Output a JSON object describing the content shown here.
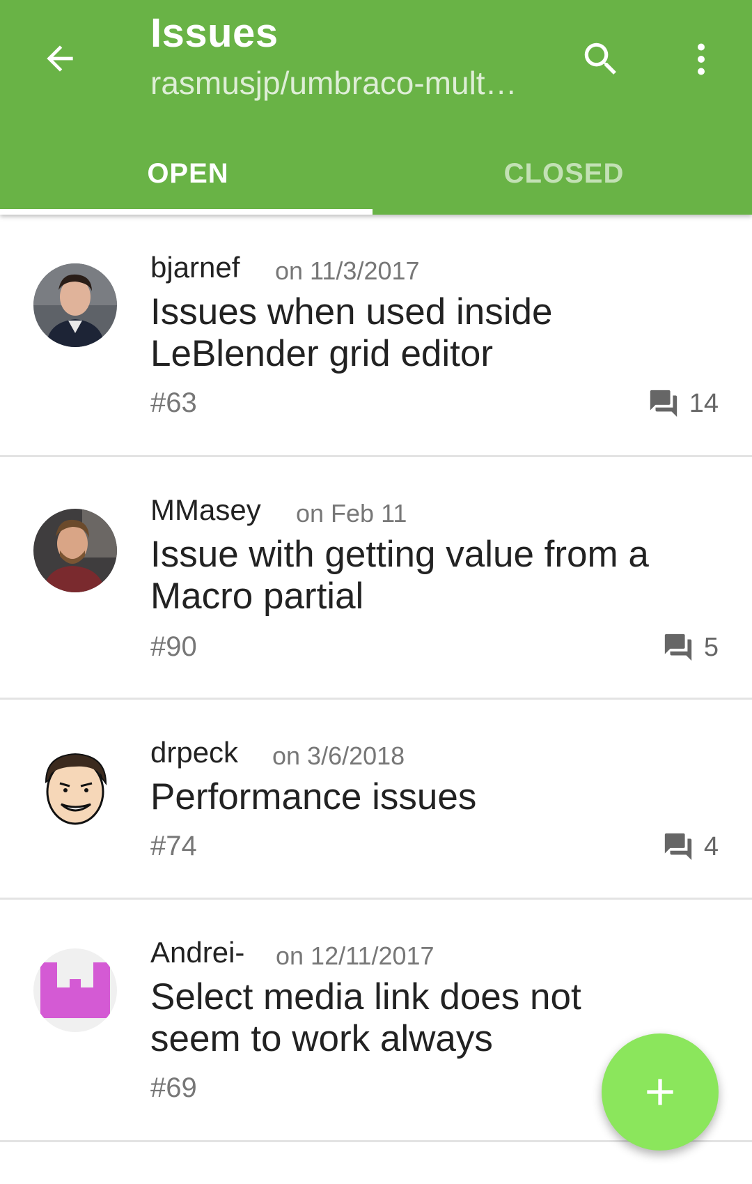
{
  "appbar": {
    "title": "Issues",
    "subtitle": "rasmusjp/umbraco-mult…",
    "back_icon": "arrow-back-icon",
    "search_icon": "search-icon",
    "more_icon": "more-vert-icon"
  },
  "tabs": [
    {
      "label": "OPEN",
      "active": true
    },
    {
      "label": "CLOSED",
      "active": false
    }
  ],
  "issues": [
    {
      "user": "bjarnef",
      "date": "on 11/3/2017",
      "title": "Issues when used inside LeBlender grid editor",
      "number": "#63",
      "comments": "14"
    },
    {
      "user": "MMasey",
      "date": "on Feb 11",
      "title": "Issue with getting value from a Macro partial",
      "number": "#90",
      "comments": "5"
    },
    {
      "user": "drpeck",
      "date": "on 3/6/2018",
      "title": "Performance issues",
      "number": "#74",
      "comments": "4"
    },
    {
      "user": "Andrei-",
      "date": "on 12/11/2017",
      "title": "Select media link does not seem to work always",
      "number": "#69",
      "comments": ""
    }
  ],
  "fab": {
    "icon": "add-icon"
  },
  "colors": {
    "primary": "#69b346",
    "fab": "#8be65c"
  }
}
